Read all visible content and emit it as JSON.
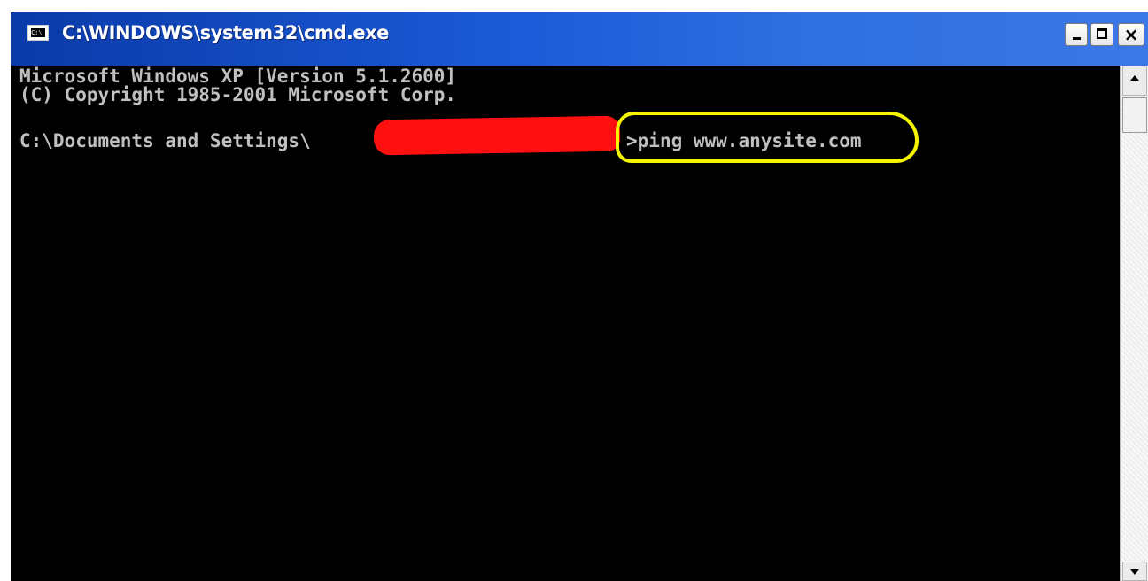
{
  "window": {
    "title": "C:\\WINDOWS\\system32\\cmd.exe",
    "icon": "console-app-icon",
    "icon_glyph": "C:\\"
  },
  "controls": {
    "minimize_icon": "minimize-icon",
    "maximize_icon": "maximize-icon",
    "close_icon": "close-icon",
    "close_glyph": "×"
  },
  "console": {
    "lines": [
      "Microsoft Windows XP [Version 5.1.2600]",
      "(C) Copyright 1985-2001 Microsoft Corp.",
      "C:\\Documents and Settings\\"
    ],
    "command": "ping www.anysite.com",
    "prompt_suffix": ">"
  },
  "annotations": {
    "redaction_color": "#ff1010",
    "highlight_color": "#f5f500"
  },
  "colors": {
    "titlebar": "#1c5bd8",
    "console_bg": "#000000",
    "console_text": "#c0c0c0"
  }
}
